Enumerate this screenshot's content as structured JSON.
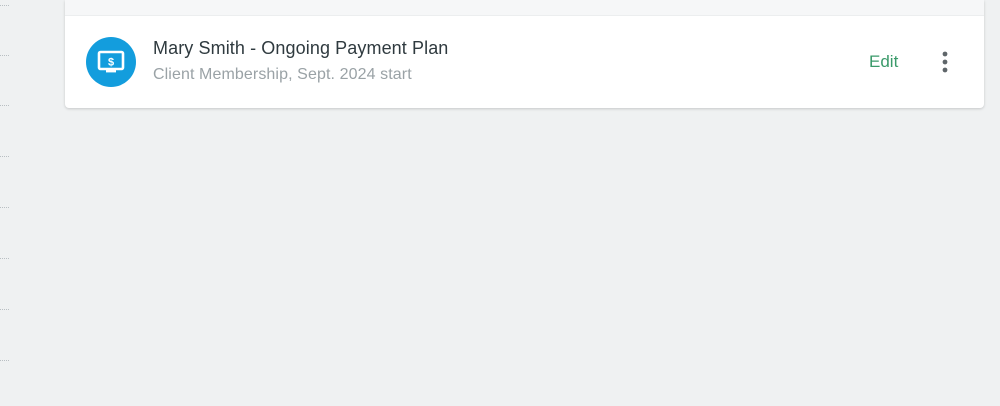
{
  "plan": {
    "title": "Mary Smith - Ongoing Payment Plan",
    "subtitle": "Client Membership, Sept. 2024 start",
    "icon": "payment-plan-icon",
    "icon_color": "#139ddd",
    "edit_label": "Edit",
    "edit_color": "#3a9a6a",
    "more_icon": "more-vertical-icon"
  }
}
